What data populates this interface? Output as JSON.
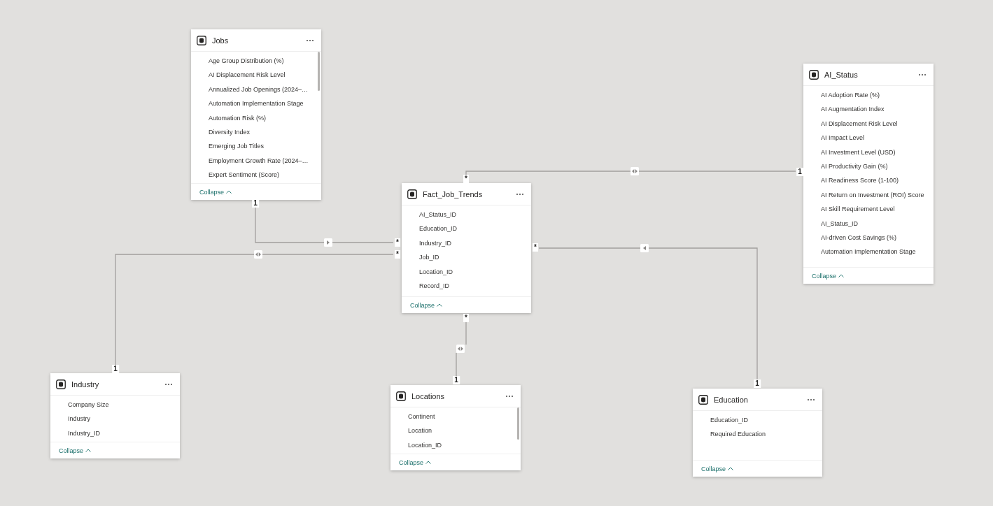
{
  "tables": [
    {
      "name": "Jobs",
      "fields": [
        "Age Group Distribution (%)",
        "AI Displacement Risk Level",
        "Annualized Job Openings (2024–…",
        "Automation Implementation Stage",
        "Automation Risk (%)",
        "Diversity Index",
        "Emerging Job Titles",
        "Employment Growth Rate (2024–…",
        "Expert Sentiment (Score)"
      ],
      "collapse": "Collapse"
    },
    {
      "name": "AI_Status",
      "fields": [
        "AI Adoption Rate (%)",
        "AI Augmentation Index",
        "AI Displacement Risk Level",
        "AI Impact Level",
        "AI Investment Level (USD)",
        "AI Productivity Gain (%)",
        "AI Readiness Score (1-100)",
        "AI Return on Investment (ROI) Score",
        "AI Skill Requirement Level",
        "AI_Status_ID",
        "AI-driven Cost Savings (%)",
        "Automation Implementation Stage"
      ],
      "collapse": "Collapse"
    },
    {
      "name": "Fact_Job_Trends",
      "fields": [
        "AI_Status_ID",
        "Education_ID",
        "Industry_ID",
        "Job_ID",
        "Location_ID",
        "Record_ID"
      ],
      "collapse": "Collapse"
    },
    {
      "name": "Industry",
      "fields": [
        "Company Size",
        "Industry",
        "Industry_ID"
      ],
      "collapse": "Collapse"
    },
    {
      "name": "Locations",
      "fields": [
        "Continent",
        "Location",
        "Location_ID"
      ],
      "collapse": "Collapse"
    },
    {
      "name": "Education",
      "fields": [
        "Education_ID",
        "Required Education"
      ],
      "collapse": "Collapse"
    }
  ],
  "relationships": [
    {
      "one_end": "1",
      "many_end": "*",
      "bidirectional": true
    },
    {
      "one_end": "1",
      "many_end": "*",
      "bidirectional": false
    },
    {
      "one_end": "1",
      "many_end": "*",
      "bidirectional": false
    },
    {
      "one_end": "1",
      "many_end": "*",
      "bidirectional": true
    },
    {
      "one_end": "1",
      "many_end": "*",
      "bidirectional": true
    }
  ]
}
